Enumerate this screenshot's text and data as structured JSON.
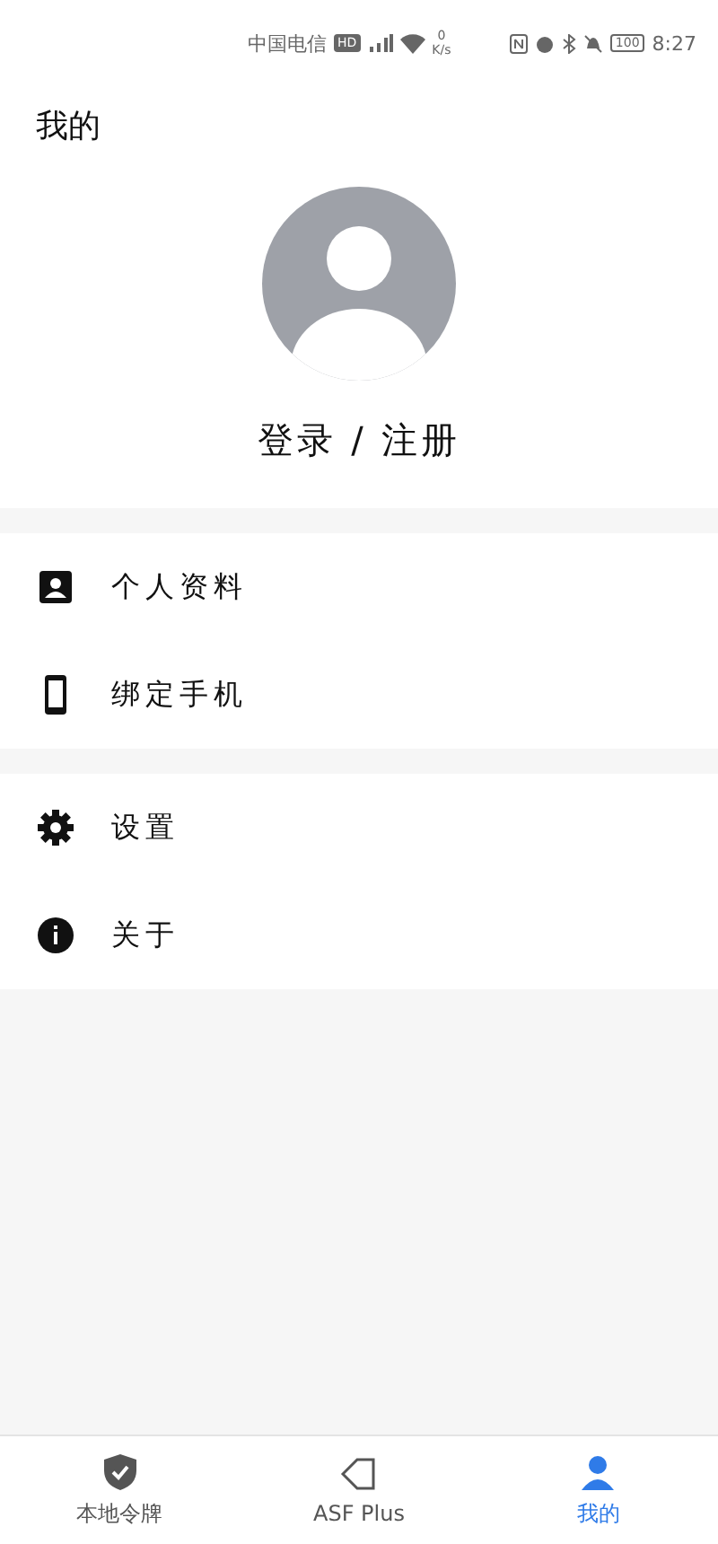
{
  "status_bar": {
    "carrier": "中国电信",
    "hd": "HD",
    "speed_value": "0",
    "speed_unit": "K/s",
    "battery": "100",
    "time": "8:27"
  },
  "header": {
    "title": "我的"
  },
  "profile": {
    "login_label": "登录 / 注册"
  },
  "menu_groups": [
    [
      {
        "label": "个人资料"
      },
      {
        "label": "绑定手机"
      }
    ],
    [
      {
        "label": "设置"
      },
      {
        "label": "关于"
      }
    ]
  ],
  "tabs": [
    {
      "label": "本地令牌",
      "selected": false
    },
    {
      "label": "ASF Plus",
      "selected": false
    },
    {
      "label": "我的",
      "selected": true
    }
  ]
}
